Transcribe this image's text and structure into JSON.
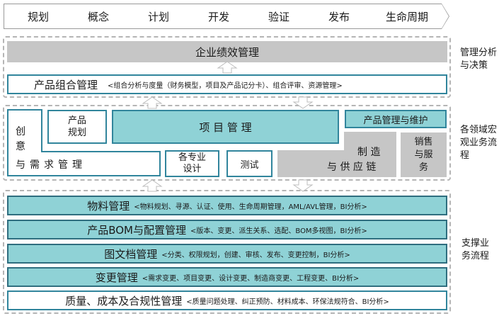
{
  "phases": [
    "规划",
    "概念",
    "计划",
    "开发",
    "验证",
    "发布",
    "生命周期"
  ],
  "mgmt": {
    "perf": "企业绩效管理",
    "portfolio_title": "产品组合管理",
    "portfolio_sub": "<组合分析与度量（财务模型，项目及产品记分卡）、组合评审、资源管理>",
    "side_label": "管理分析与决策"
  },
  "domain": {
    "req_col": "创意",
    "req_row": "与需求管理",
    "product_planning": "产品规划",
    "project_mgmt": "项 目 管 理",
    "product_maint": "产品管理与维护",
    "specialty_design": "各专业设计",
    "test": "测试",
    "supply_line1": "制 造",
    "supply_line2": "与 供 应 链",
    "sales": "销售与服务",
    "side_label": "各领域宏观业务流程"
  },
  "support": {
    "rows": [
      {
        "title": "物料管理",
        "sub": "<物料规划、寻源、认证、使用、生命周期管理，AML/AVL管理，BI分析>"
      },
      {
        "title": "产品BOM与配置管理",
        "sub": "<版本、变更、派生关系、选配、BOM多视图，BI分析>"
      },
      {
        "title": "图文档管理",
        "sub": "<分类、权限规划，创建、审核、发布、变更控制，BI分析>"
      },
      {
        "title": "变更管理",
        "sub": "<需求变更、项目变更、设计变更、制造商变更、工程变更、BI分析>"
      },
      {
        "title": "质量、成本及合规性管理",
        "sub": "<质量问题处理、纠正预防、材料成本、环保法规符合、BI分析>"
      }
    ],
    "side_label": "支撑业务流程"
  },
  "colors": {
    "teal_fill": "#8fd2d6",
    "teal_border": "#31859c",
    "gray_fill": "#c6c6c6"
  },
  "icons": [
    "up-arrow-icon",
    "down-arrow-icon"
  ]
}
